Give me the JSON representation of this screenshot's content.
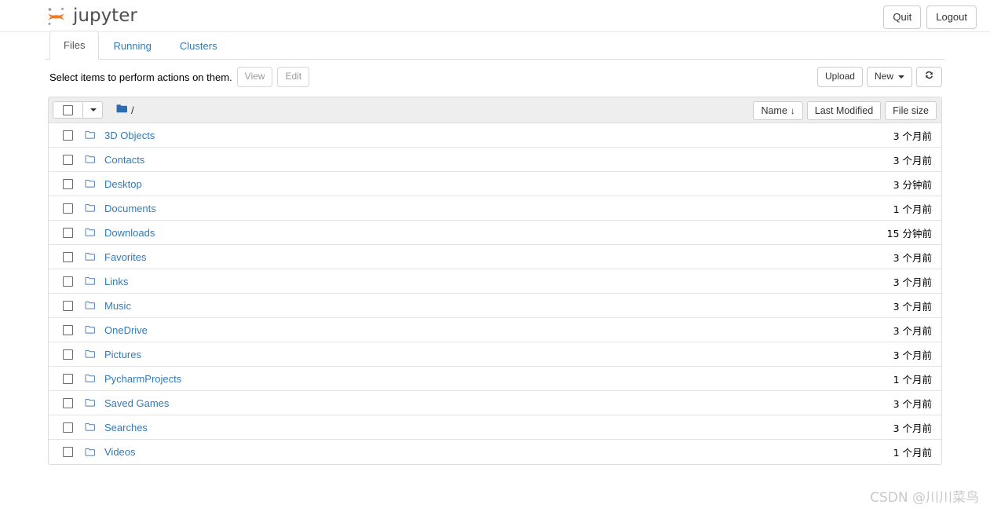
{
  "header": {
    "brand_name": "jupyter",
    "logo_icon": "jupyter-logo",
    "quit_label": "Quit",
    "logout_label": "Logout"
  },
  "tabs": [
    {
      "label": "Files",
      "active": true
    },
    {
      "label": "Running",
      "active": false
    },
    {
      "label": "Clusters",
      "active": false
    }
  ],
  "toolbar": {
    "hint": "Select items to perform actions on them.",
    "view_label": "View",
    "edit_label": "Edit",
    "upload_label": "Upload",
    "new_label": "New",
    "new_caret_icon": "chevron-down-icon",
    "refresh_icon": "refresh-icon"
  },
  "list_header": {
    "select_all_icon": "checkbox-unchecked-icon",
    "select_caret_icon": "chevron-down-icon",
    "breadcrumb_folder_icon": "folder-filled-icon",
    "breadcrumb_path": "/",
    "sorters": [
      {
        "label": "Name",
        "arrow": "↓",
        "active": true
      },
      {
        "label": "Last Modified",
        "arrow": "",
        "active": false
      },
      {
        "label": "File size",
        "arrow": "",
        "active": false
      }
    ]
  },
  "files": [
    {
      "name": "3D Objects",
      "modified": "3 个月前",
      "icon": "folder-icon",
      "checkbox": "checkbox-unchecked-icon"
    },
    {
      "name": "Contacts",
      "modified": "3 个月前",
      "icon": "folder-icon",
      "checkbox": "checkbox-unchecked-icon"
    },
    {
      "name": "Desktop",
      "modified": "3 分钟前",
      "icon": "folder-icon",
      "checkbox": "checkbox-unchecked-icon"
    },
    {
      "name": "Documents",
      "modified": "1 个月前",
      "icon": "folder-icon",
      "checkbox": "checkbox-unchecked-icon"
    },
    {
      "name": "Downloads",
      "modified": "15 分钟前",
      "icon": "folder-icon",
      "checkbox": "checkbox-unchecked-icon"
    },
    {
      "name": "Favorites",
      "modified": "3 个月前",
      "icon": "folder-icon",
      "checkbox": "checkbox-unchecked-icon"
    },
    {
      "name": "Links",
      "modified": "3 个月前",
      "icon": "folder-icon",
      "checkbox": "checkbox-unchecked-icon"
    },
    {
      "name": "Music",
      "modified": "3 个月前",
      "icon": "folder-icon",
      "checkbox": "checkbox-unchecked-icon"
    },
    {
      "name": "OneDrive",
      "modified": "3 个月前",
      "icon": "folder-icon",
      "checkbox": "checkbox-unchecked-icon"
    },
    {
      "name": "Pictures",
      "modified": "3 个月前",
      "icon": "folder-icon",
      "checkbox": "checkbox-unchecked-icon"
    },
    {
      "name": "PycharmProjects",
      "modified": "1 个月前",
      "icon": "folder-icon",
      "checkbox": "checkbox-unchecked-icon"
    },
    {
      "name": "Saved Games",
      "modified": "3 个月前",
      "icon": "folder-icon",
      "checkbox": "checkbox-unchecked-icon"
    },
    {
      "name": "Searches",
      "modified": "3 个月前",
      "icon": "folder-icon",
      "checkbox": "checkbox-unchecked-icon"
    },
    {
      "name": "Videos",
      "modified": "1 个月前",
      "icon": "folder-icon",
      "checkbox": "checkbox-unchecked-icon"
    }
  ],
  "watermark": "CSDN @川川菜鸟",
  "colors": {
    "link": "#337ab7",
    "brand_orange": "#f37726",
    "brand_gray": "#9e9e9e",
    "folder_blue": "#2b6cb3",
    "header_bg": "#eeeeee",
    "border": "#dddddd"
  }
}
